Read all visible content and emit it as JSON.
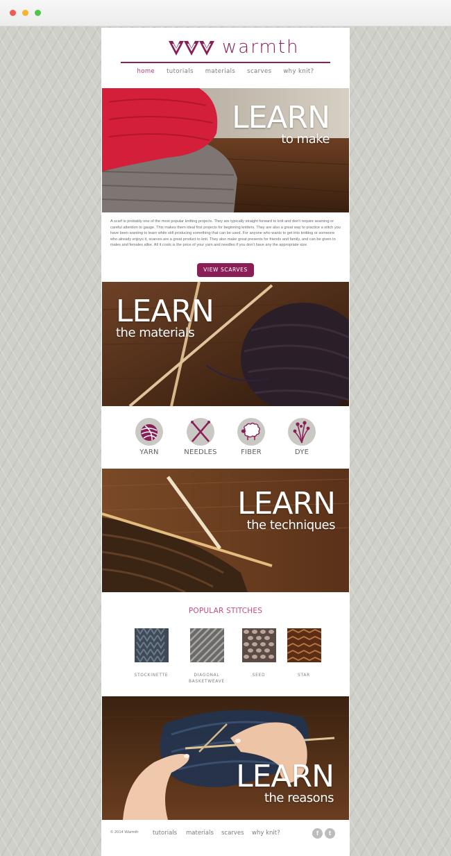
{
  "brand": {
    "name": "warmth",
    "accent": "#8a1f58",
    "pink": "#c9497e"
  },
  "nav": [
    {
      "label": "home",
      "active": true
    },
    {
      "label": "tutorials",
      "active": false
    },
    {
      "label": "materials",
      "active": false
    },
    {
      "label": "scarves",
      "active": false
    },
    {
      "label": "why knit?",
      "active": false
    }
  ],
  "hero1": {
    "big": "LEARN",
    "small": "to make"
  },
  "intro": {
    "text": "A scarf is probably one of the most popular knitting projects. They are typically straight forward to knit and don't require seaming or careful attention to gauge. This makes them ideal first projects for beginning knitters. They are also a great way to practice a stitch you have been wanting to learn while still producing something that can be used. For anyone who wants to get into knitting or someone who already enjoys it, scarves are a great product to knit. They also make great presents for friends and family, and can be given to males and females alike. All it costs is the price of your yarn and needles if you don't have any the appropriate size.",
    "button": "VIEW SCARVES"
  },
  "hero2": {
    "big": "LEARN",
    "small": "the materials"
  },
  "materials": [
    {
      "label": "YARN",
      "icon": "yarn-ball-icon"
    },
    {
      "label": "NEEDLES",
      "icon": "crossed-needles-icon"
    },
    {
      "label": "FIBER",
      "icon": "sheep-icon"
    },
    {
      "label": "DYE",
      "icon": "flowers-icon"
    }
  ],
  "hero3": {
    "big": "LEARN",
    "small": "the techniques"
  },
  "stitches": {
    "title": "POPULAR STITCHES",
    "items": [
      {
        "label": "STOCKINETTE"
      },
      {
        "label": "DIAGONAL\nBASKETWEAVE"
      },
      {
        "label": "SEED"
      },
      {
        "label": "STAR"
      }
    ]
  },
  "hero4": {
    "big": "LEARN",
    "small": "the reasons"
  },
  "footer": {
    "copyright": "© 2014 Warmth",
    "links": [
      "tutorials",
      "materials",
      "scarves",
      "why knit?"
    ],
    "social": [
      "facebook-icon",
      "twitter-icon"
    ]
  }
}
